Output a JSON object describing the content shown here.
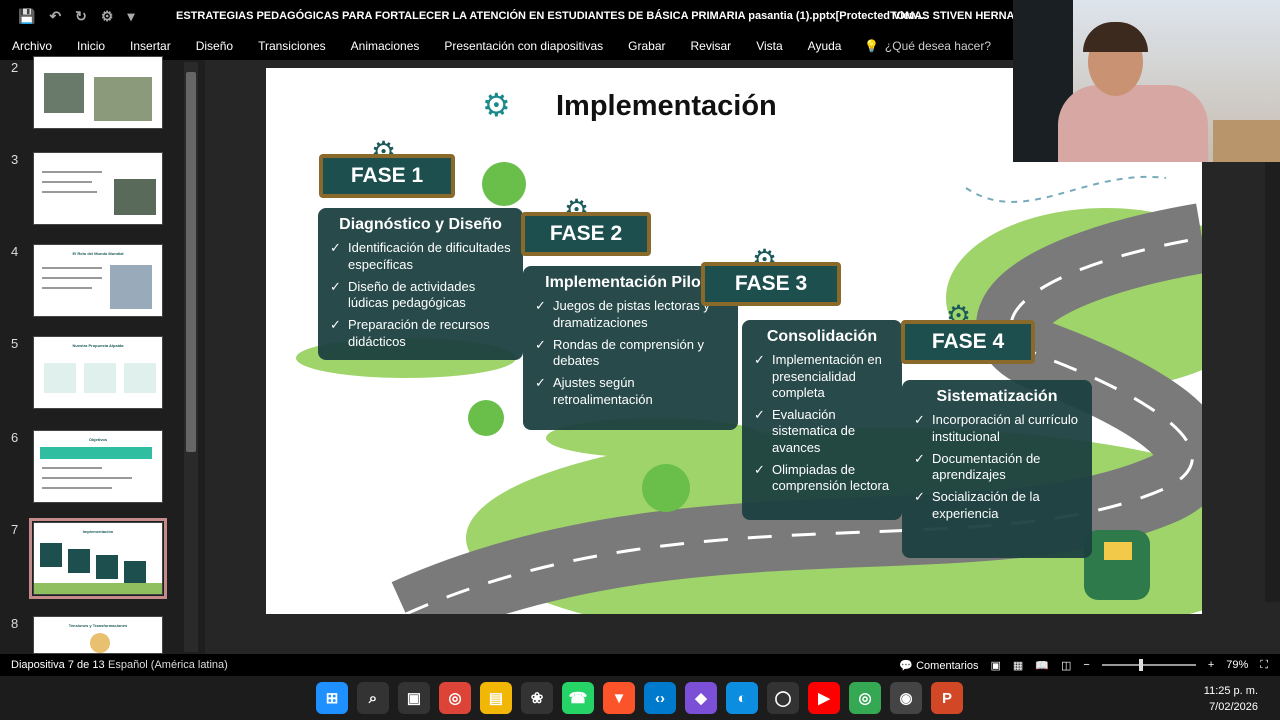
{
  "window": {
    "document_title": "ESTRATEGIAS PEDAGÓGICAS PARA FORTALECER LA ATENCIÓN EN ESTUDIANTES DE BÁSICA PRIMARIA pasantia (1).pptx[Protected View...",
    "user_name": "TOMAS STIVEN HERNAND"
  },
  "ribbon": {
    "tabs": [
      "Archivo",
      "Inicio",
      "Insertar",
      "Diseño",
      "Transiciones",
      "Animaciones",
      "Presentación con diapositivas",
      "Grabar",
      "Revisar",
      "Vista",
      "Ayuda"
    ],
    "tell_me": "¿Qué desea hacer?"
  },
  "thumbnails": [
    {
      "number": "2",
      "title": ""
    },
    {
      "number": "3",
      "title": ""
    },
    {
      "number": "4",
      "title": "El Reto del Mundo Mundial"
    },
    {
      "number": "5",
      "title": "Nuestra Propuesta Alpaida"
    },
    {
      "number": "6",
      "title": "Objetivos"
    },
    {
      "number": "7",
      "title": "Implementación"
    },
    {
      "number": "8",
      "title": "Tensiones y Transformaciones"
    }
  ],
  "slide": {
    "title": "Implementación",
    "phases": [
      {
        "sign": "FASE 1",
        "heading": "Diagnóstico y Diseño",
        "items": [
          "Identificación de dificultades específicas",
          "Diseño de actividades lúdicas pedagógicas",
          "Preparación de recursos didácticos"
        ]
      },
      {
        "sign": "FASE 2",
        "heading": "Implementación Piloto",
        "items": [
          "Juegos de pistas lectoras y dramatizaciones",
          "Rondas de comprensión y debates",
          "Ajustes según retroalimentación"
        ]
      },
      {
        "sign": "FASE 3",
        "heading": "Consolidación",
        "items": [
          "Implementación en presencialidad completa",
          "Evaluación sistematica de avances",
          "Olimpiadas de comprensión lectora"
        ]
      },
      {
        "sign": "FASE 4",
        "heading": "Sistematización",
        "items": [
          "Incorporación al currículo institucional",
          "Documentación de aprendizajes",
          "Socialización de la experiencia"
        ]
      }
    ]
  },
  "statusbar": {
    "slide_counter": "Diapositiva 7 de 13",
    "language": "Español (América latina)",
    "comments": "Comentarios",
    "zoom": "79%"
  },
  "taskbar": {
    "time": "11:25 p. m.",
    "date": "7/02/2026",
    "apps": [
      {
        "icon": "windows-start-icon",
        "color": "#1e90ff"
      },
      {
        "icon": "search-icon",
        "color": "#333"
      },
      {
        "icon": "task-view-icon",
        "color": "#333"
      },
      {
        "icon": "chrome-icon",
        "color": "#db4437"
      },
      {
        "icon": "file-explorer-icon",
        "color": "#f2b705"
      },
      {
        "icon": "chatgpt-icon",
        "color": "#333"
      },
      {
        "icon": "whatsapp-icon",
        "color": "#25d366"
      },
      {
        "icon": "brave-icon",
        "color": "#fb542b"
      },
      {
        "icon": "vscode-icon",
        "color": "#007acc"
      },
      {
        "icon": "m365-icon",
        "color": "#7b4fd6"
      },
      {
        "icon": "edge-icon",
        "color": "#0c8de0"
      },
      {
        "icon": "copilot-icon",
        "color": "#333"
      },
      {
        "icon": "youtube-icon",
        "color": "#ff0000"
      },
      {
        "icon": "chrome-profile-icon",
        "color": "#34a853"
      },
      {
        "icon": "obs-icon",
        "color": "#444"
      },
      {
        "icon": "powerpoint-icon",
        "color": "#d24726"
      }
    ]
  }
}
